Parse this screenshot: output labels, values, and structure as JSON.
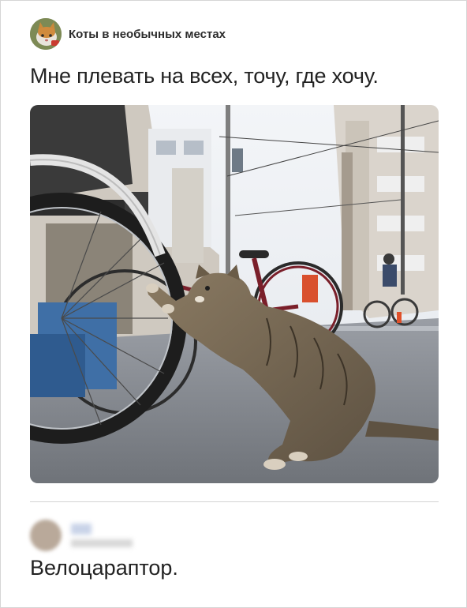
{
  "group": {
    "name": "Коты в необычных местах",
    "avatar_icon": "cat-face-icon"
  },
  "post": {
    "text": "Мне плевать на всех, точу, где хочу.",
    "image_description_icon": "photo"
  },
  "comment": {
    "author_name": "",
    "author_meta": "",
    "text": "Велоцараптор."
  },
  "colors": {
    "text": "#222222",
    "divider": "#d3d3d3",
    "frame_border": "#d6d6d6"
  }
}
